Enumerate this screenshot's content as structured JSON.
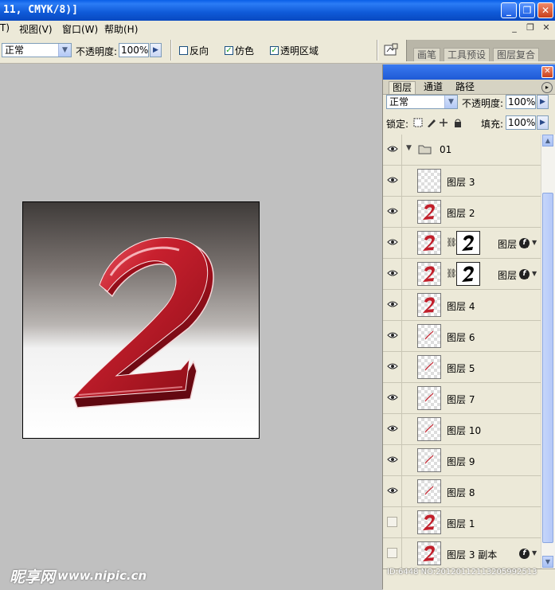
{
  "window": {
    "title": "11, CMYK/8)]"
  },
  "menu": {
    "items": [
      "T)",
      "视图(V)",
      "窗口(W)",
      "帮助(H)"
    ]
  },
  "options": {
    "mode_value": "正常",
    "opacity_label": "不透明度:",
    "opacity_value": "100%",
    "reverse_label": "反向",
    "dither_label": "仿色",
    "transparency_label": "透明区域",
    "tabs": [
      "画笔",
      "工具预设",
      "图层复合"
    ]
  },
  "artwork": {
    "digit": "2"
  },
  "layers_panel": {
    "tabs": [
      "图层",
      "通道",
      "路径"
    ],
    "blend_mode": "正常",
    "opacity_label": "不透明度:",
    "opacity_value": "100%",
    "lock_label": "锁定:",
    "fill_label": "填充:",
    "fill_value": "100%",
    "group_name": "01",
    "layers": [
      {
        "name": "图层 3",
        "visible": true,
        "thumb": "empty",
        "mask": false,
        "fx": false
      },
      {
        "name": "图层 2",
        "visible": true,
        "thumb": "two",
        "mask": false,
        "fx": false
      },
      {
        "name": "图层 ...",
        "visible": true,
        "thumb": "two",
        "mask": true,
        "fx": true
      },
      {
        "name": "图层 ...",
        "visible": true,
        "thumb": "two",
        "mask": true,
        "fx": true
      },
      {
        "name": "图层 4",
        "visible": true,
        "thumb": "two",
        "mask": false,
        "fx": false
      },
      {
        "name": "图层 6",
        "visible": true,
        "thumb": "stroke",
        "mask": false,
        "fx": false
      },
      {
        "name": "图层 5",
        "visible": true,
        "thumb": "stroke",
        "mask": false,
        "fx": false
      },
      {
        "name": "图层 7",
        "visible": true,
        "thumb": "stroke",
        "mask": false,
        "fx": false
      },
      {
        "name": "图层 10",
        "visible": true,
        "thumb": "stroke",
        "mask": false,
        "fx": false
      },
      {
        "name": "图层 9",
        "visible": true,
        "thumb": "stroke",
        "mask": false,
        "fx": false
      },
      {
        "name": "图层 8",
        "visible": true,
        "thumb": "stroke",
        "mask": false,
        "fx": false
      },
      {
        "name": "图层 1",
        "visible": false,
        "thumb": "two",
        "mask": false,
        "fx": false
      },
      {
        "name": "图层 3 副本",
        "visible": false,
        "thumb": "two",
        "mask": false,
        "fx": true
      }
    ]
  },
  "watermark": {
    "logo": "昵享网",
    "site": "www.nipic.cn",
    "id_text": "ID:6448 NO:20120112113205992513"
  }
}
